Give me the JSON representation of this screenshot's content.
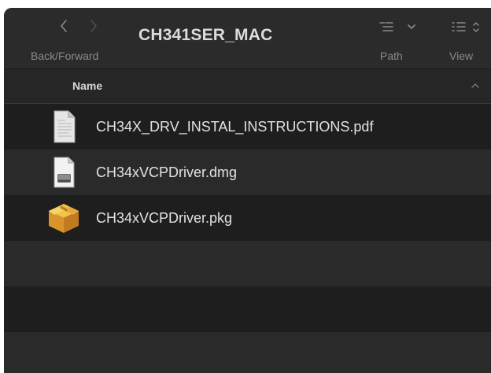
{
  "window": {
    "title": "CH341SER_MAC"
  },
  "toolbar": {
    "backforward_label": "Back/Forward",
    "path_label": "Path",
    "view_label": "View",
    "back_icon": "chevron-left-icon",
    "forward_icon": "chevron-right-icon",
    "path_icon": "list-path-icon",
    "view_icon": "list-view-icon"
  },
  "columns": {
    "name_label": "Name",
    "sort_icon": "chevron-up-icon"
  },
  "files": [
    {
      "name": "CH34X_DRV_INSTAL_INSTRUCTIONS.pdf",
      "icon": "pdf-document-icon"
    },
    {
      "name": "CH34xVCPDriver.dmg",
      "icon": "disk-image-icon"
    },
    {
      "name": "CH34xVCPDriver.pkg",
      "icon": "package-icon"
    }
  ],
  "colors": {
    "background": "#1e1e1e",
    "toolbar": "#2b2b2b",
    "row_alt": "#2a2a2a",
    "text": "#e2e2e2",
    "muted_text": "#8a8a8a"
  }
}
